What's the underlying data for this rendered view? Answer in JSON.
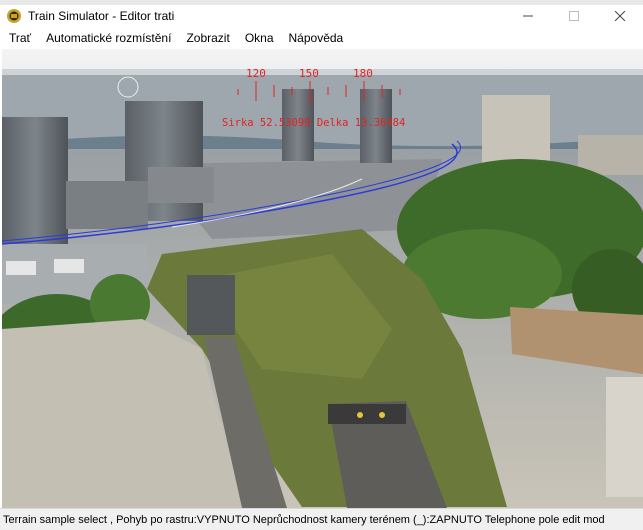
{
  "taskbar": {
    "items": [
      "",
      "",
      "",
      "",
      "",
      "",
      "",
      "",
      ""
    ]
  },
  "window": {
    "title": "Train Simulator - Editor trati"
  },
  "menu": {
    "items": [
      "Trať",
      "Automatické rozmístění",
      "Zobrazit",
      "Okna",
      "Nápověda"
    ]
  },
  "hud": {
    "compass_ticks": [
      "120",
      "150",
      "180"
    ],
    "coordinates": "Sirka 52.53099 Delka 13.36484"
  },
  "status": {
    "text": "Terrain sample select , Pohyb po rastru:VYPNUTO Neprůchodnost kamery terénem (_):ZAPNUTO Telephone pole edit mod"
  },
  "colors": {
    "hud": "#e02424",
    "track_marker": "#2a3bd8",
    "grass": "#6b7a3a"
  },
  "icons": {
    "app": "train-sim-icon",
    "minimize": "minimize-icon",
    "maximize": "maximize-icon",
    "close": "close-icon"
  }
}
